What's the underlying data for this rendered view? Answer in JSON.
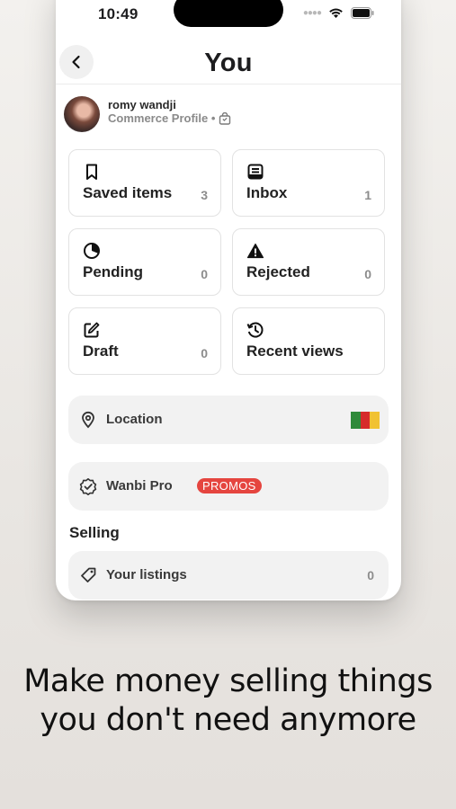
{
  "status_bar": {
    "time": "10:49"
  },
  "header": {
    "title": "You",
    "back_icon": "chevron-left-icon"
  },
  "profile": {
    "name": "romy wandji",
    "subtitle": "Commerce Profile •",
    "badge_icon": "shopping-bag-icon"
  },
  "cards": [
    {
      "label": "Saved items",
      "count": "3",
      "icon": "bookmark-icon"
    },
    {
      "label": "Inbox",
      "count": "1",
      "icon": "inbox-icon"
    },
    {
      "label": "Pending",
      "count": "0",
      "icon": "pie-clock-icon"
    },
    {
      "label": "Rejected",
      "count": "0",
      "icon": "warning-icon"
    },
    {
      "label": "Draft",
      "count": "0",
      "icon": "edit-icon"
    },
    {
      "label": "Recent views",
      "count": "",
      "icon": "history-icon"
    }
  ],
  "location": {
    "label": "Location",
    "flag_colors": [
      "#2f8a3a",
      "#d62b2b",
      "#f1c232"
    ]
  },
  "pro": {
    "label": "Wanbi Pro",
    "badge": "PROMOS",
    "badge_color": "#e5453f"
  },
  "selling": {
    "section_title": "Selling",
    "listings_label": "Your listings",
    "listings_count": "0"
  },
  "tagline": {
    "line1": "Make money selling things",
    "line2": "you don't need anymore"
  }
}
